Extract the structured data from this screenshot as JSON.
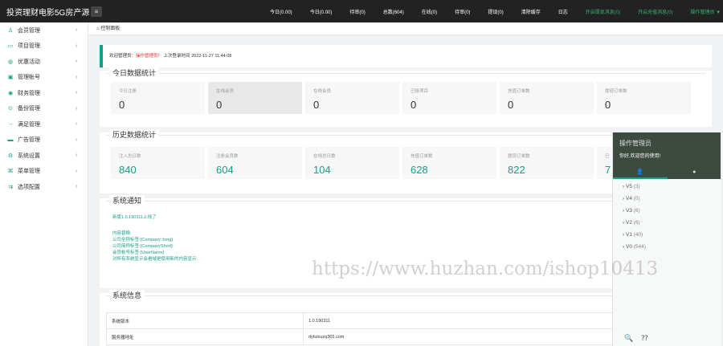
{
  "header": {
    "brand": "投资理财电影5G房产源",
    "menu_icon": "≡",
    "nav": [
      {
        "label": "今日(0.00)",
        "green": false
      },
      {
        "label": "今日(0.00)",
        "green": false
      },
      {
        "label": "待审(0)",
        "green": false
      },
      {
        "label": "总数(604)",
        "green": false
      },
      {
        "label": "在线(0)",
        "green": false
      },
      {
        "label": "待审(0)",
        "green": false
      },
      {
        "label": "提现(0)",
        "green": false
      },
      {
        "label": "清除缓存",
        "green": false
      },
      {
        "label": "日志",
        "green": false
      },
      {
        "label": "开启提现消息(0)",
        "green": true
      },
      {
        "label": "开启充值消息(0)",
        "green": true
      },
      {
        "label": "操作管理员 ▼",
        "green": true
      }
    ]
  },
  "sidebar": {
    "items": [
      {
        "label": "会员管理",
        "icon": "person"
      },
      {
        "label": "项目管理",
        "icon": "project"
      },
      {
        "label": "优惠活动",
        "icon": "gift"
      },
      {
        "label": "管理帐号",
        "icon": "account"
      },
      {
        "label": "财务管理",
        "icon": "finance"
      },
      {
        "label": "备份管理",
        "icon": "backup"
      },
      {
        "label": "满足管理",
        "icon": "arrow"
      },
      {
        "label": "广告管理",
        "icon": "ad"
      },
      {
        "label": "系统设置",
        "icon": "gear"
      },
      {
        "label": "菜单管理",
        "icon": "menu"
      },
      {
        "label": "选项配置",
        "icon": "option"
      }
    ],
    "arrow": "‹"
  },
  "breadcrumb": "⌂ 控制面板",
  "welcome": {
    "prefix": "欢迎管理员：",
    "role": "操作管理员",
    "suffix": "！ 上次登录时间 2022-11-27 11:44:08"
  },
  "today": {
    "title": "今日数据统计",
    "cards": [
      {
        "label": "今日注册",
        "value": "0"
      },
      {
        "label": "在线会员",
        "value": "0"
      },
      {
        "label": "在线会员",
        "value": "0"
      },
      {
        "label": "已投项目",
        "value": "0"
      },
      {
        "label": "充值订单数",
        "value": "0"
      },
      {
        "label": "提现订单数",
        "value": "0"
      }
    ]
  },
  "history": {
    "title": "历史数据统计",
    "cards": [
      {
        "label": "注入总日数",
        "value": "840"
      },
      {
        "label": "注册会员数",
        "value": "604"
      },
      {
        "label": "在线总日数",
        "value": "104"
      },
      {
        "label": "充值订单数",
        "value": "628"
      },
      {
        "label": "提现订单数",
        "value": "822"
      },
      {
        "label": "已",
        "value": "7"
      }
    ]
  },
  "notice": {
    "title": "系统通知",
    "lines": [
      "新版1.0.190311上线了",
      "",
      "内容替换:",
      "公司全称标签:{Company::long}",
      "公司简称标签:{CompanyShort}",
      "会员帐号标签:{UserName}",
      "对所有系统显示会看域是使用新的内容显示"
    ]
  },
  "sysinfo": {
    "title": "系统信息",
    "rows": [
      {
        "k": "系统版本",
        "v": "1.0.190311"
      },
      {
        "k": "服务器地址",
        "v": "dytulxuzq365.com"
      }
    ]
  },
  "overlay": {
    "title": "操作管理员",
    "subtitle": "你好,欢迎您的使用!",
    "tab_user": "👤",
    "tab_dot": "●",
    "levels": [
      {
        "name": "V5",
        "count": "(3)"
      },
      {
        "name": "V4",
        "count": "(0)"
      },
      {
        "name": "V3",
        "count": "(6)"
      },
      {
        "name": "V2",
        "count": "(6)"
      },
      {
        "name": "V1",
        "count": "(40)"
      },
      {
        "name": "V0",
        "count": "(544)"
      }
    ],
    "foot_search": "🔍",
    "foot_help": "⁇"
  },
  "watermark": "https://www.huzhan.com/ishop10413"
}
